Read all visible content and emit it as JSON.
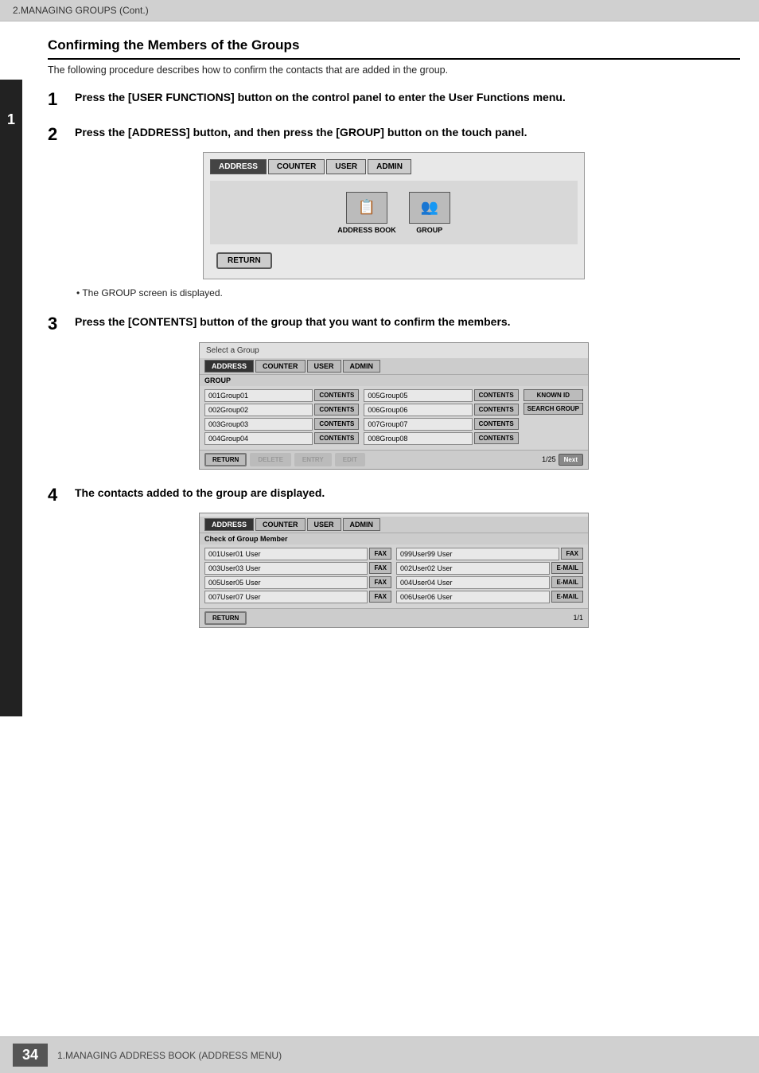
{
  "header": {
    "text": "2.MANAGING GROUPS (Cont.)"
  },
  "section_title": "Confirming the Members of the Groups",
  "intro": "The following procedure describes how to confirm the contacts that are added in the group.",
  "steps": [
    {
      "number": "1",
      "text": "Press the [USER FUNCTIONS] button on the control panel to enter the User Functions menu."
    },
    {
      "number": "2",
      "text": "Press the [ADDRESS] button, and then press the [GROUP] button on the touch panel."
    },
    {
      "number": "3",
      "text": "Press the [CONTENTS] button of the group that you want to confirm the members."
    },
    {
      "number": "4",
      "text": "The contacts added to the group are displayed."
    }
  ],
  "screen1": {
    "tabs": [
      "ADDRESS",
      "COUNTER",
      "USER",
      "ADMIN"
    ],
    "active_tab": "ADDRESS",
    "icons": [
      {
        "label": "ADDRESS BOOK",
        "icon": "📋"
      },
      {
        "label": "GROUP",
        "icon": "👥"
      }
    ],
    "return_btn": "RETURN"
  },
  "bullet_note": "The GROUP screen is displayed.",
  "screen2": {
    "title": "Select a Group",
    "tabs": [
      "ADDRESS",
      "COUNTER",
      "USER",
      "ADMIN"
    ],
    "active_tab": "ADDRESS",
    "group_label": "GROUP",
    "groups_left": [
      {
        "name": "001Group01",
        "btn": "CONTENTS"
      },
      {
        "name": "002Group02",
        "btn": "CONTENTS"
      },
      {
        "name": "003Group03",
        "btn": "CONTENTS"
      },
      {
        "name": "004Group04",
        "btn": "CONTENTS"
      }
    ],
    "groups_right": [
      {
        "name": "005Group05",
        "btn": "CONTENTS"
      },
      {
        "name": "006Group06",
        "btn": "CONTENTS"
      },
      {
        "name": "007Group07",
        "btn": "CONTENTS"
      },
      {
        "name": "008Group08",
        "btn": "CONTENTS"
      }
    ],
    "sidebar_btns": [
      "KNOWN ID",
      "SEARCH GROUP"
    ],
    "footer_btns": [
      "RETURN",
      "DELETE",
      "ENTRY",
      "EDIT"
    ],
    "page": "1/25",
    "next_btn": "Next"
  },
  "screen3": {
    "title": "Check of Group Member",
    "tabs": [
      "ADDRESS",
      "COUNTER",
      "USER",
      "ADMIN"
    ],
    "active_tab": "ADDRESS",
    "members_left": [
      {
        "name": "001User01 User",
        "type": "FAX"
      },
      {
        "name": "003User03 User",
        "type": "FAX"
      },
      {
        "name": "005User05 User",
        "type": "FAX"
      },
      {
        "name": "007User07 User",
        "type": "FAX"
      }
    ],
    "members_right": [
      {
        "name": "099User99 User",
        "type": "FAX"
      },
      {
        "name": "002User02 User",
        "type": "E-MAIL"
      },
      {
        "name": "004User04 User",
        "type": "E-MAIL"
      },
      {
        "name": "006User06 User",
        "type": "E-MAIL"
      }
    ],
    "return_btn": "RETURN",
    "page": "1/1"
  },
  "footer": {
    "page_num": "34",
    "text": "1.MANAGING ADDRESS BOOK (ADDRESS MENU)"
  }
}
